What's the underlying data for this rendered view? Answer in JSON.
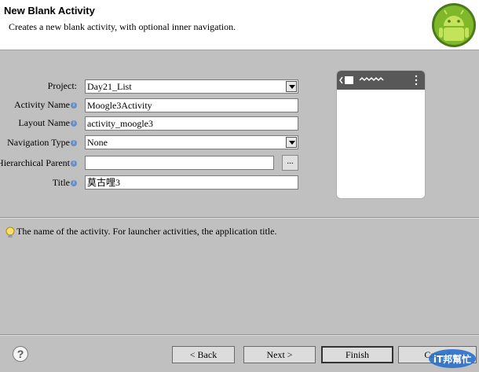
{
  "header": {
    "title": "New Blank Activity",
    "description": "Creates a new blank activity, with optional inner navigation."
  },
  "form": {
    "project_label": "Project:",
    "project_value": "Day21_List",
    "activity_name_label": "Activity Name",
    "activity_name_value": "Moogle3Activity",
    "layout_name_label": "Layout Name",
    "layout_name_value": "activity_moogle3",
    "navigation_type_label": "Navigation Type",
    "navigation_type_value": "None",
    "hierarchical_parent_label": "Hierarchical Parent",
    "hierarchical_parent_value": "",
    "browse_label": "...",
    "title_label": "Title",
    "title_value": "莫古哩3"
  },
  "message": "The name of the activity. For launcher activities, the application title.",
  "buttons": {
    "help": "?",
    "back": "< Back",
    "next": "Next >",
    "finish": "Finish",
    "cancel": "Cancel"
  },
  "watermark": "iT邦幫忙",
  "colors": {
    "android_green": "#a4c639",
    "watermark_blue": "#2a6fc9"
  }
}
